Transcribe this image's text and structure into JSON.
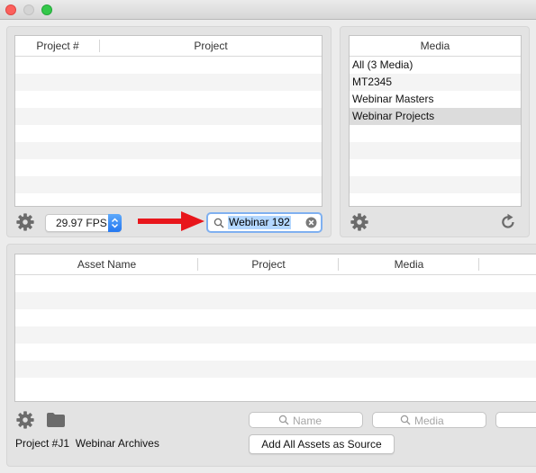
{
  "colors": {
    "accent_blue": "#2f7df6",
    "selection": "#dcdcdc",
    "arrow_red": "#e8161b",
    "text_highlight": "#b3d7ff"
  },
  "project_table": {
    "columns": [
      "Project #",
      "Project"
    ],
    "rows": []
  },
  "fps_select": {
    "value": "29.97 FPS"
  },
  "project_search": {
    "value": "Webinar 192"
  },
  "media_list": {
    "header": "Media",
    "items": [
      "All (3 Media)",
      "MT2345",
      "Webinar Masters",
      "Webinar Projects"
    ],
    "selected": "Webinar Projects"
  },
  "asset_table": {
    "columns": [
      "Asset Name",
      "Project",
      "Media"
    ],
    "rows": []
  },
  "filters": {
    "name_placeholder": "Name",
    "media_placeholder": "Media"
  },
  "footer": {
    "project_code": "Project #J1",
    "project_name": "Webinar Archives",
    "add_button": "Add All Assets as Source"
  },
  "icons": {
    "settings": "gear-icon",
    "folder": "folder-icon",
    "refresh": "refresh-icon",
    "search": "search-icon",
    "clear": "clear-icon",
    "pointer": "red-arrow"
  }
}
